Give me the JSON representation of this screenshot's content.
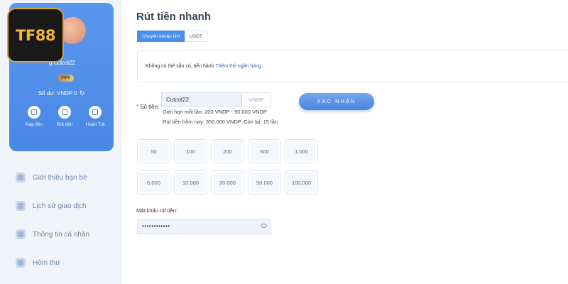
{
  "logo": {
    "text": "TF88"
  },
  "profile": {
    "username": "g Cutcot22",
    "vip": "VIP0",
    "balance_label": "Số dư: VNDP 0"
  },
  "quick_actions": [
    {
      "label": "Nạp tiền"
    },
    {
      "label": "Rút tiền"
    },
    {
      "label": "Hoàn Trả"
    }
  ],
  "menu": [
    {
      "label": "Giới thiệu bạn bè"
    },
    {
      "label": "Lịch sử giao dịch"
    },
    {
      "label": "Thông tin cá nhân"
    },
    {
      "label": "Hòm thư"
    }
  ],
  "page": {
    "title": "Rút tiền nhanh",
    "tabs": [
      {
        "label": "Chuyển khoản NH"
      },
      {
        "label": "USDT"
      }
    ],
    "notice": {
      "text": "Không có thẻ sẵn có, tiến hành ",
      "link": "Thêm thẻ ngân hàng",
      "suffix": " ."
    },
    "amount": {
      "label": "Số tiền:",
      "value": "Cutcot22",
      "currency": "VNDP",
      "limit_per_time": "Giới hạn mỗi lần: 200 VNDP - 90.000 VNDP",
      "limit_today": "Rút tiền hôm nay: 350.000 VNDP, Còn lại: 15 lần"
    },
    "confirm_label": "XÁC NHẬN",
    "amount_options": [
      "50",
      "100",
      "200",
      "500",
      "1.000",
      "5.000",
      "10.000",
      "20.000",
      "50.000",
      "100.000"
    ],
    "password": {
      "label": "Mật khẩu rút tiền:",
      "value": "••••••••••••"
    }
  }
}
